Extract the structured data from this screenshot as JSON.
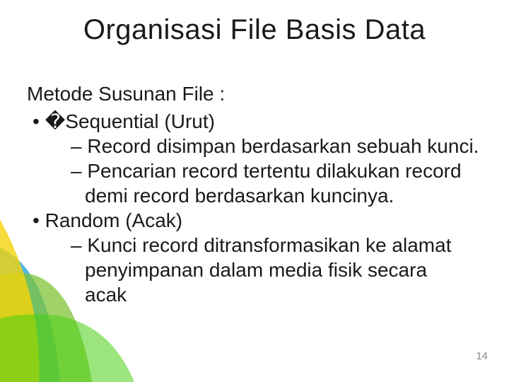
{
  "title": "Organisasi File Basis Data",
  "intro": "Metode Susunan File :",
  "items": [
    {
      "label_prefix": "�",
      "label": "Sequential (Urut)",
      "subs": [
        "Record disimpan berdasarkan sebuah kunci.",
        "Pencarian record tertentu dilakukan record demi record berdasarkan kuncinya."
      ]
    },
    {
      "label_prefix": "",
      "label": "Random (Acak)",
      "subs": [
        "Kunci record ditransformasikan ke alamat penyimpanan dalam media fisik secara"
      ],
      "cutoff": "acak"
    }
  ],
  "page_number": "14",
  "decor_colors": {
    "blue": "#2fa9e0",
    "green": "#7fc336",
    "yellow": "#f5d40a",
    "bright_green": "#49d011"
  }
}
